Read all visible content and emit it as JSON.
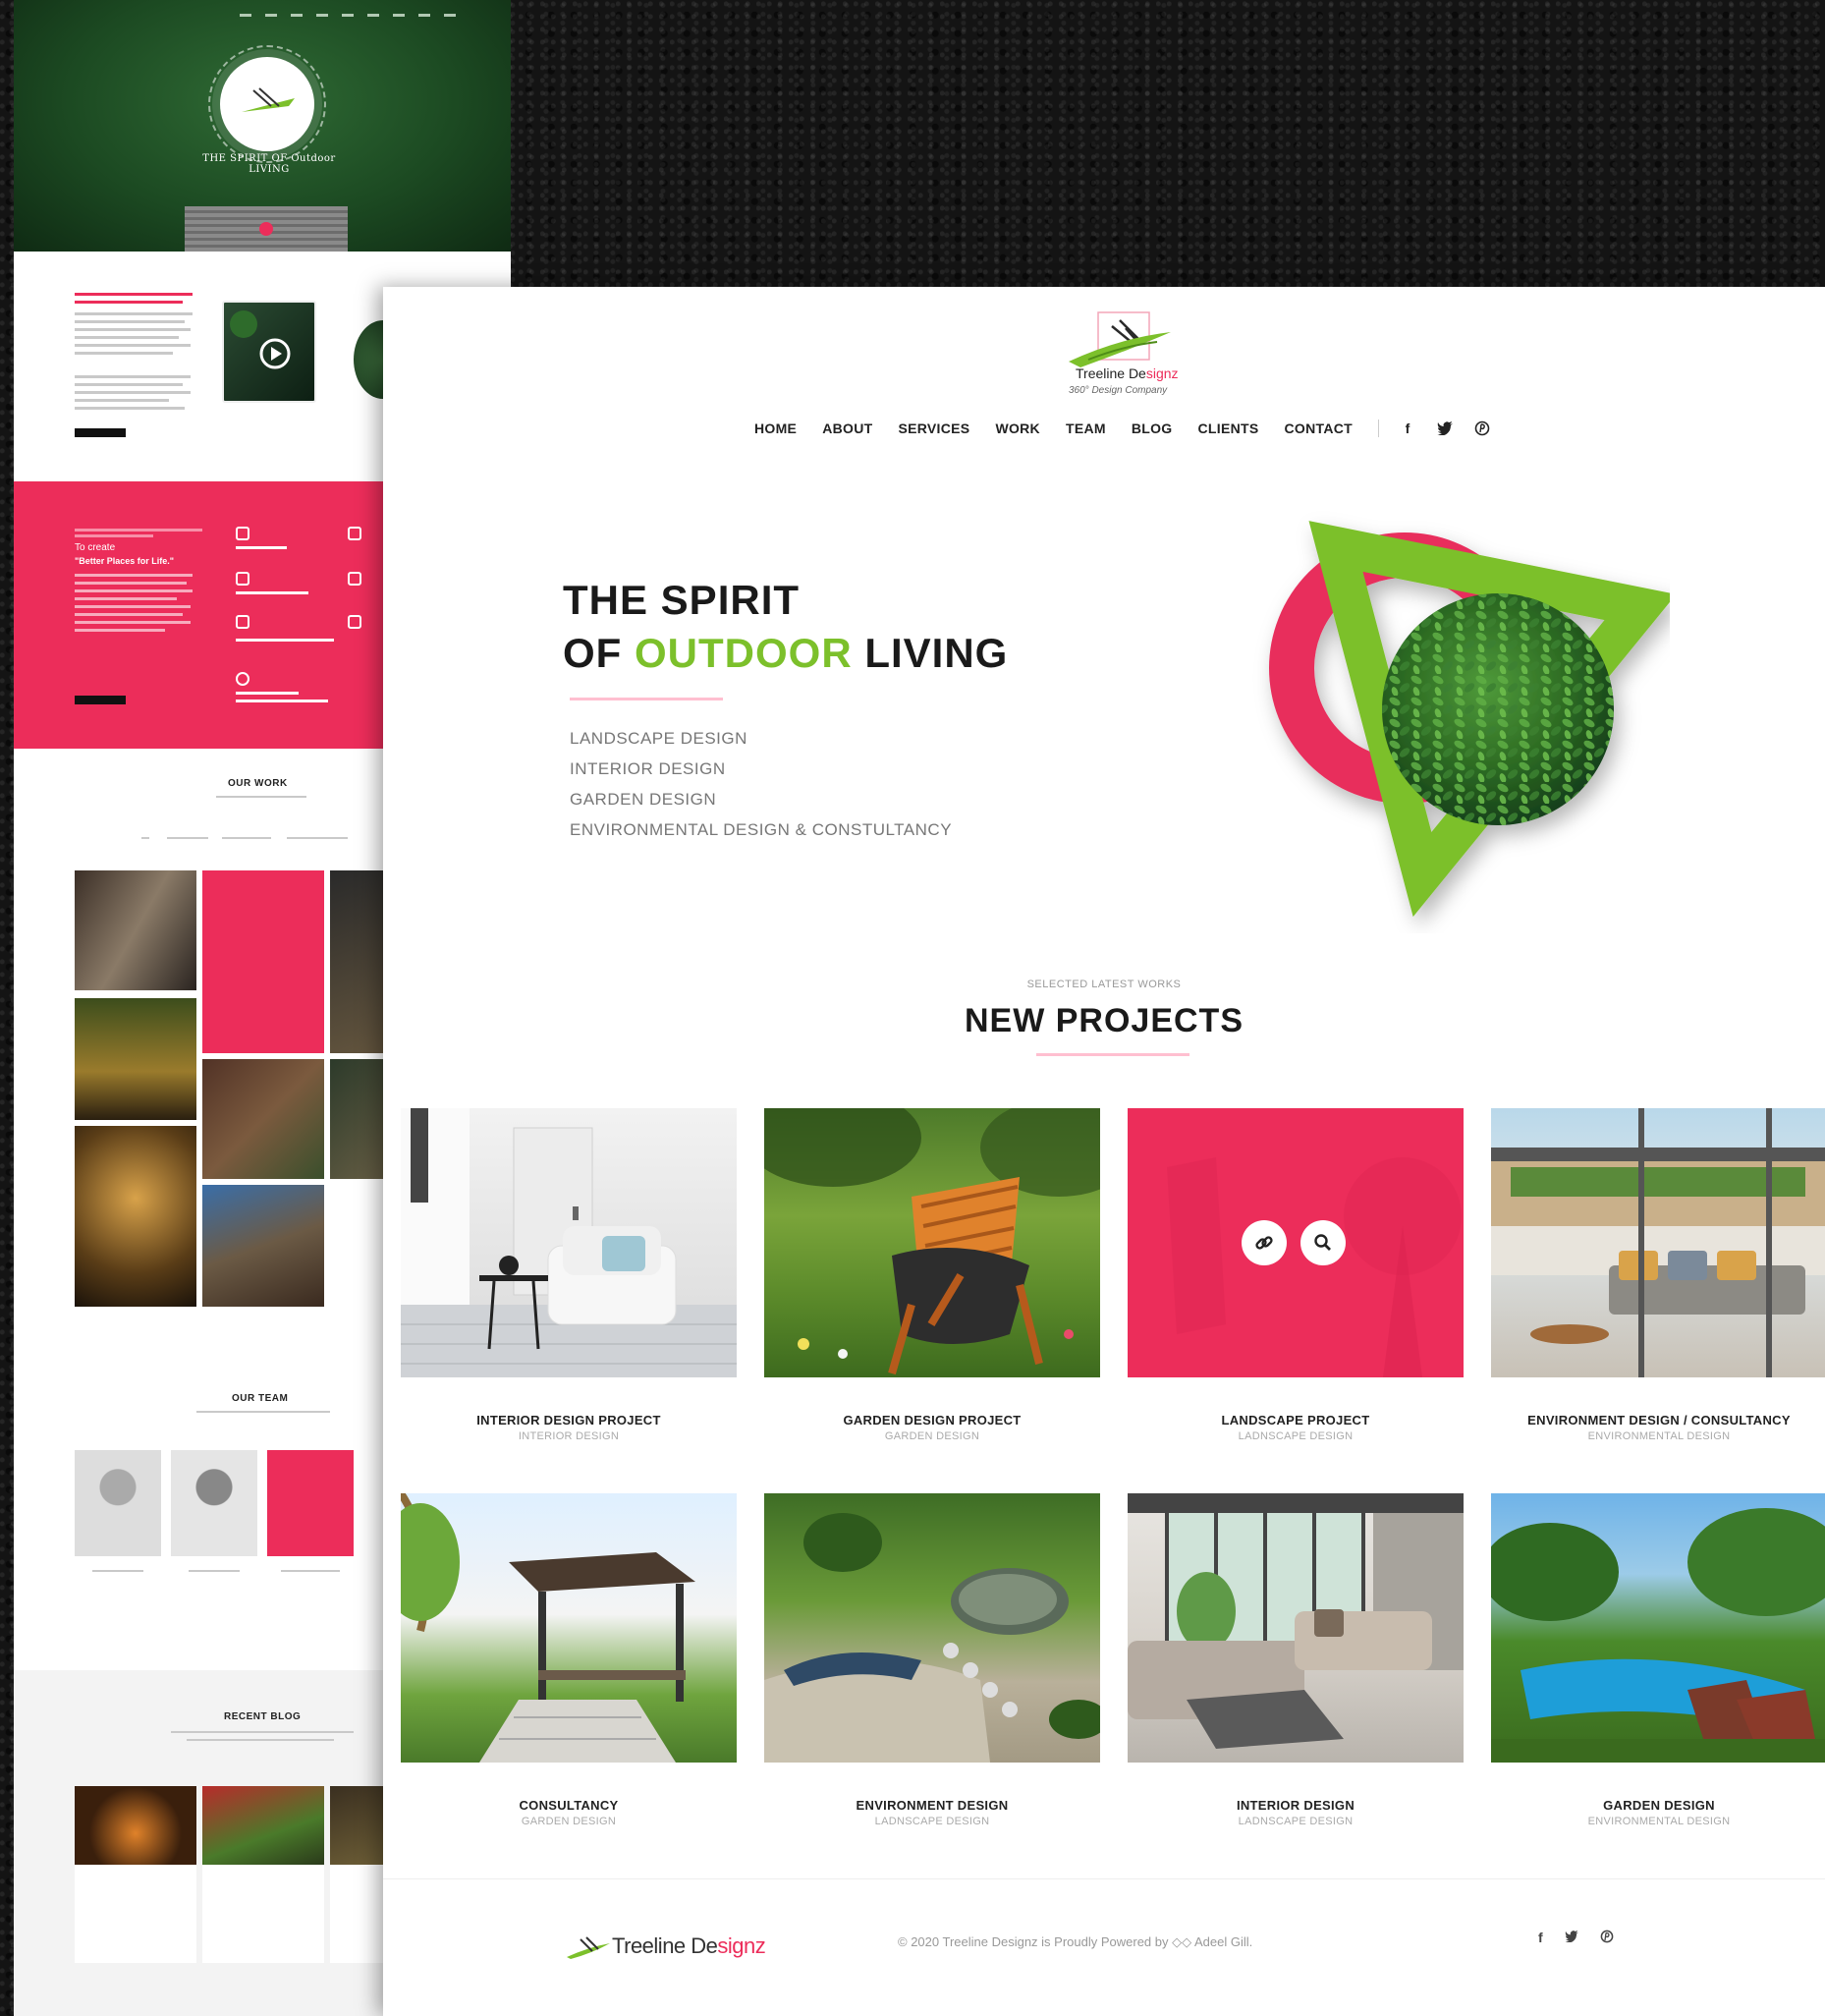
{
  "colors": {
    "accent_pink": "#ec2d5a",
    "accent_green": "#7cc02b",
    "text_dark": "#1a1a1a"
  },
  "back_page": {
    "hero_tagline": "THE SPIRIT OF Outdoor LIVING",
    "pink_quote": "\"Better Places for Life.\"",
    "pink_lead": "To create",
    "sections": {
      "work": "OUR WORK",
      "team": "OUR TEAM",
      "blog": "RECENT BLOG"
    }
  },
  "logo": {
    "name_part1": "Treeline De",
    "name_part2": "signz",
    "tagline": "360° Design Company"
  },
  "nav": {
    "items": [
      "HOME",
      "ABOUT",
      "SERVICES",
      "WORK",
      "TEAM",
      "BLOG",
      "CLIENTS",
      "CONTACT"
    ],
    "social": [
      "facebook-icon",
      "twitter-icon",
      "pinterest-icon"
    ],
    "social_glyphs": {
      "facebook": "f",
      "twitter": "t",
      "pinterest": "®"
    }
  },
  "hero": {
    "line1": "THE SPIRIT",
    "line2_pre": "OF ",
    "line2_accent": "OUTDOOR",
    "line2_post": " LIVING",
    "services": [
      "LANDSCAPE DESIGN",
      "INTERIOR DESIGN",
      "GARDEN DESIGN",
      "ENVIRONMENTAL DESIGN & CONSTULTANCY"
    ]
  },
  "projects_section": {
    "kicker": "SELECTED LATEST WORKS",
    "title": "NEW PROJECTS"
  },
  "projects": [
    {
      "title": "INTERIOR DESIGN PROJECT",
      "category": "INTERIOR DESIGN",
      "scene": "interior-white-room"
    },
    {
      "title": "GARDEN DESIGN PROJECT",
      "category": "GARDEN DESIGN",
      "scene": "garden-chair"
    },
    {
      "title": "LANDSCAPE PROJECT",
      "category": "LADNSCAPE DESIGN",
      "scene": "pink-hover-overlay"
    },
    {
      "title": "ENVIRONMENT DESIGN / CONSULTANCY",
      "category": "ENVIRONMENTAL DESIGN",
      "scene": "terrace-lounge"
    },
    {
      "title": "CONSULTANCY",
      "category": "GARDEN DESIGN",
      "scene": "pergola"
    },
    {
      "title": "ENVIRONMENT DESIGN",
      "category": "LADNSCAPE DESIGN",
      "scene": "stone-garden"
    },
    {
      "title": "INTERIOR DESIGN",
      "category": "LADNSCAPE DESIGN",
      "scene": "living-room"
    },
    {
      "title": "GARDEN DESIGN",
      "category": "ENVIRONMENTAL DESIGN",
      "scene": "pool-garden"
    }
  ],
  "overlay_icons": [
    "link-icon",
    "search-icon"
  ],
  "footer": {
    "logo_part1": "Treeline De",
    "logo_part2": "signz",
    "copyright": "© 2020 Treeline Designz is Proudly Powered by ◇◇ Adeel Gill.",
    "social_glyphs": {
      "facebook": "f",
      "twitter": "t",
      "pinterest": "®"
    }
  }
}
